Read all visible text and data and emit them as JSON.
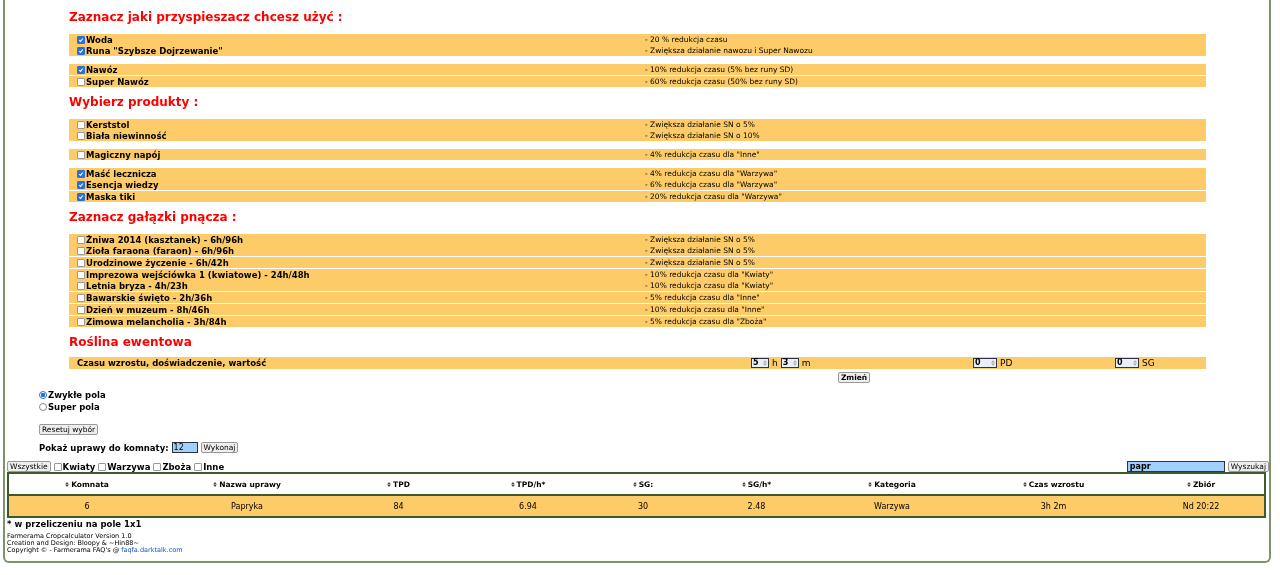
{
  "sections": [
    {
      "heading": "Zaznacz jaki przyspieszacz chcesz użyć :",
      "groups": [
        {
          "bands": [
            [
              {
                "label": "Woda",
                "checked": true,
                "description": "- 20 % redukcja czasu"
              },
              {
                "label": "Runa \"Szybsze Dojrzewanie\"",
                "checked": true,
                "description": "- Zwiększa działanie nawozu i Super Nawozu"
              }
            ]
          ]
        },
        {
          "bands": [
            [
              {
                "label": "Nawóz",
                "checked": true,
                "description": "- 10% redukcja czasu (5% bez runy SD)"
              }
            ],
            [
              {
                "label": "Super Nawóz",
                "checked": false,
                "description": "- 60% redukcja czasu (50% bez runy SD)"
              }
            ]
          ]
        }
      ]
    },
    {
      "heading": "Wybierz produkty :",
      "groups": [
        {
          "bands": [
            [
              {
                "label": "Kerststol",
                "checked": false,
                "description": "- Zwiększa działanie SN o 5%"
              },
              {
                "label": "Biała niewinność",
                "checked": false,
                "description": "- Zwiększa działanie SN o 10%"
              }
            ]
          ]
        },
        {
          "bands": [
            [
              {
                "label": "Magiczny napój",
                "checked": false,
                "description": "- 4% redukcja czasu dla \"Inne\""
              }
            ]
          ]
        },
        {
          "bands": [
            [
              {
                "label": "Maść lecznicza",
                "checked": true,
                "description": "- 4% redukcja czasu dla \"Warzywa\""
              },
              {
                "label": "Esencja wiedzy",
                "checked": true,
                "description": "- 6% redukcja czasu dla \"Warzywa\""
              }
            ],
            [
              {
                "label": "Maska tiki",
                "checked": true,
                "description": "- 20% redukcja czasu dla \"Warzywa\""
              }
            ]
          ]
        }
      ]
    },
    {
      "heading": "Zaznacz gałązki pnącza :",
      "groups": [
        {
          "bands": [
            [
              {
                "label": "Żniwa 2014 (kasztanek) - 6h/96h",
                "checked": false,
                "description": "- Zwiększa działanie SN o 5%"
              },
              {
                "label": "Zioła faraona (faraon) - 6h/96h",
                "checked": false,
                "description": "- Zwiększa działanie SN o 5%"
              }
            ],
            [
              {
                "label": "Urodzinowe życzenie - 6h/42h",
                "checked": false,
                "description": "- Zwiększa działanie SN o 5%"
              }
            ],
            [
              {
                "label": "Imprezowa wejściówka 1 (kwiatowe) - 24h/48h",
                "checked": false,
                "description": "- 10% redukcja czasu dla \"Kwiaty\""
              },
              {
                "label": "Letnia bryza - 4h/23h",
                "checked": false,
                "description": "- 10% redukcja czasu dla \"Kwiaty\""
              }
            ],
            [
              {
                "label": "Bawarskie święto - 2h/36h",
                "checked": false,
                "description": "- 5% redukcja czasu dla \"Inne\""
              }
            ],
            [
              {
                "label": "Dzień w muzeum - 8h/46h",
                "checked": false,
                "description": "- 10% redukcja czasu dla \"Inne\""
              }
            ],
            [
              {
                "label": "Zimowa melancholia - 3h/84h",
                "checked": false,
                "description": "- 5% redukcja czasu dla \"Zboża\""
              }
            ]
          ]
        }
      ]
    }
  ],
  "event_plant": {
    "heading": "Roślina ewentowa",
    "label": "Czasu wzrostu, doświadczenie, wartość",
    "hours": "5",
    "hours_unit": "h",
    "minutes": "3",
    "minutes_unit": "m",
    "xp": "0",
    "xp_unit": "PD",
    "value": "0",
    "value_unit": "SG",
    "button": "Zmień"
  },
  "field_types": [
    {
      "label": "Zwykłe pola",
      "selected": true
    },
    {
      "label": "Super pola",
      "selected": false
    }
  ],
  "reset_button": "Resetuj wybór",
  "room_filter": {
    "label": "Pokaż uprawy do komnaty:",
    "value": "12",
    "button": "Wykonaj"
  },
  "category_filter": {
    "all_button": "Wszystkie",
    "categories": [
      {
        "label": "Kwiaty",
        "checked": false
      },
      {
        "label": "Warzywa",
        "checked": false
      },
      {
        "label": "Zboża",
        "checked": false
      },
      {
        "label": "Inne",
        "checked": false
      }
    ],
    "search": "papr",
    "search_button": "Wyszukaj"
  },
  "table": {
    "columns": [
      "Komnata",
      "Nazwa uprawy",
      "TPD",
      "TPD/h*",
      "SG:",
      "SG/h*",
      "Kategoria",
      "Czas wzrostu",
      "Zbiór"
    ],
    "rows": [
      [
        "6",
        "Papryka",
        "84",
        "6.94",
        "30",
        "2.48",
        "Warzywa",
        "3h 2m",
        "Nd 20:22"
      ]
    ]
  },
  "footnote": "* w przeliczeniu na pole 1x1",
  "footer": {
    "lines": [
      "Farmerama Cropcalculator Version 1.0",
      "Creation and Design: Bloopy & ~Hin88~"
    ],
    "copyright": "Copyright © - Farmerama FAQ's @",
    "link": "faqfa.darktalk.com"
  }
}
